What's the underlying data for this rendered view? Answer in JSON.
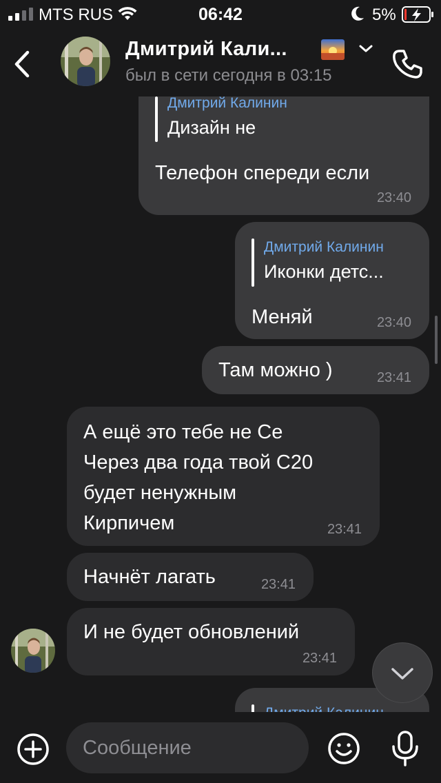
{
  "status_bar": {
    "carrier": "MTS RUS",
    "time": "06:42",
    "battery_percent": "5%",
    "battery_level": 0.05,
    "icons": [
      "signal-icon",
      "wifi-icon",
      "moon-icon",
      "battery-charging-icon"
    ]
  },
  "header": {
    "contact_name": "Дмитрий Кали...",
    "last_seen": "был в сети сегодня в 03:15",
    "icons": [
      "back-chevron-icon",
      "status-emoji-icon",
      "chevron-down-icon",
      "phone-icon"
    ]
  },
  "messages": [
    {
      "direction": "out",
      "reply_author": "Дмитрий Калинин",
      "reply_text": "Дизайн не",
      "text": "Телефон  спереди если",
      "time": "23:40"
    },
    {
      "direction": "out",
      "reply_author": "Дмитрий Калинин",
      "reply_text": "Иконки детс...",
      "text": "Меняй",
      "time": "23:40"
    },
    {
      "direction": "out",
      "text": "Там можно )",
      "time": "23:41"
    },
    {
      "direction": "in",
      "lines": [
        "А ещё это тебе не Се",
        "Через два года твой С20",
        "будет ненужным",
        "Кирпичем"
      ],
      "time": "23:41"
    },
    {
      "direction": "in",
      "text": "Начнёт лагать",
      "time": "23:41"
    },
    {
      "direction": "in",
      "text": "И не будет обновлений",
      "time": "23:41"
    },
    {
      "direction": "out",
      "reply_author": "Дмитрий Калинин",
      "partial": true
    }
  ],
  "composer": {
    "placeholder": "Сообщение",
    "icons": [
      "add-icon",
      "emoji-icon",
      "microphone-icon"
    ]
  },
  "colors": {
    "background": "#19191a",
    "incoming_bubble": "#2c2c2e",
    "outgoing_bubble": "#3a3a3c",
    "reply_author": "#71aaeb",
    "secondary_text": "#8e8e93"
  }
}
